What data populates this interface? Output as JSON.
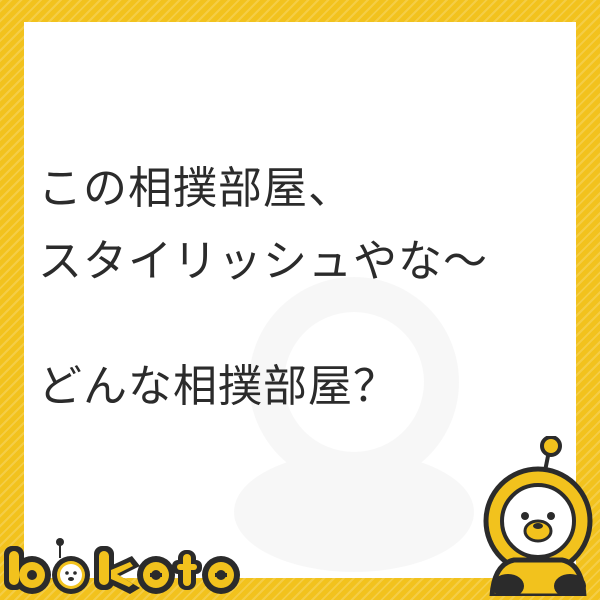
{
  "caption": {
    "line1": "この相撲部屋、",
    "line2": "スタイリッシュやな〜",
    "line3": "どんな相撲部屋？"
  },
  "brand": {
    "logo_text": "bokete",
    "mascot_icon": "lion-mascot-icon"
  },
  "colors": {
    "frame": "#f2c21d",
    "panel": "#ffffff",
    "text": "#2b2b2b",
    "logo_fill": "#f2c21d",
    "logo_outline": "#2b2b2b"
  }
}
